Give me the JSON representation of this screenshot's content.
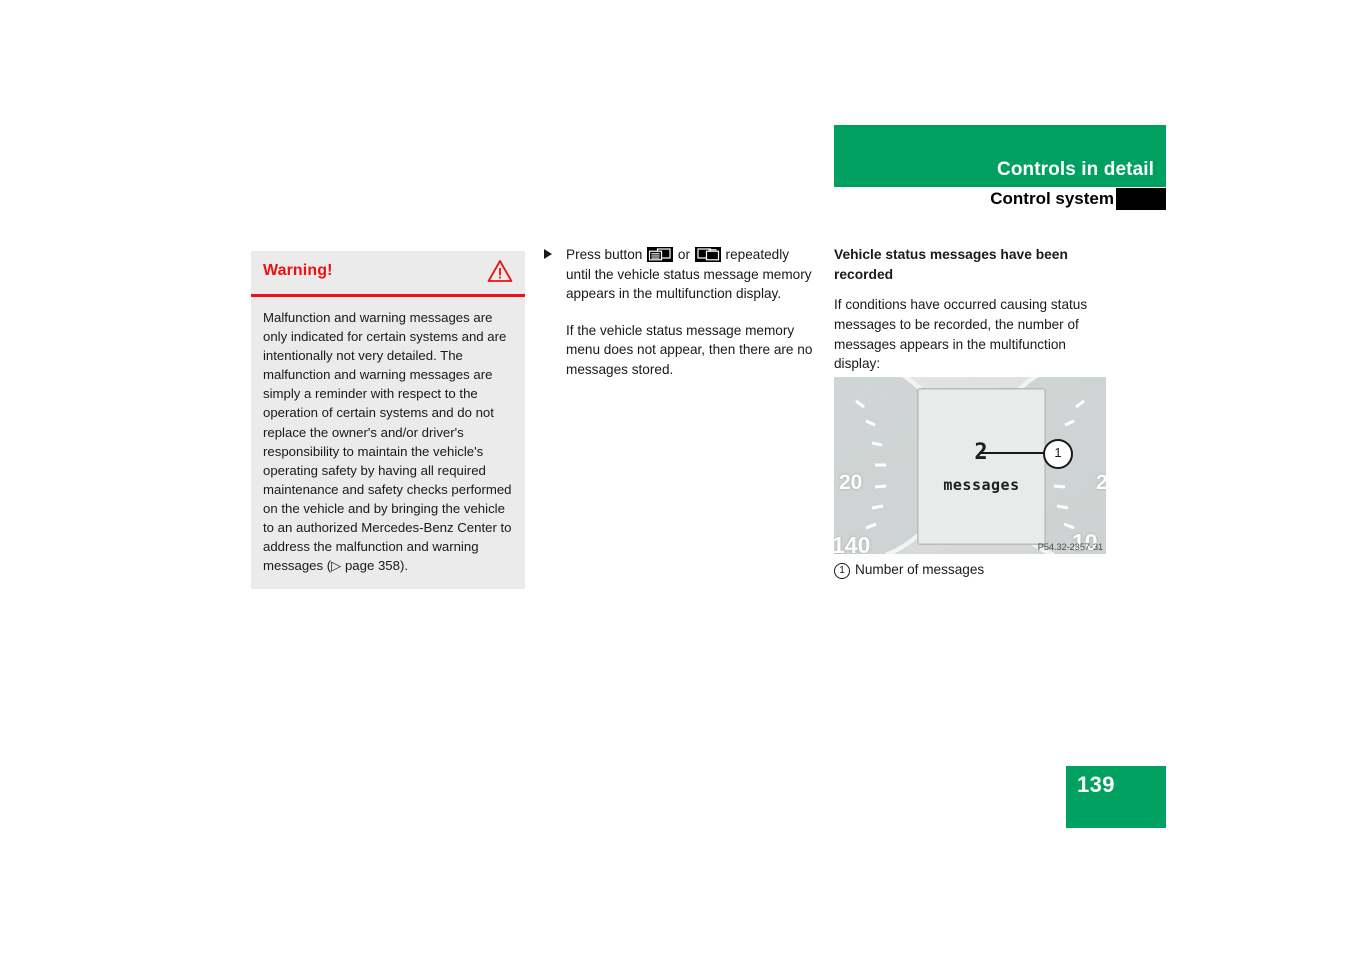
{
  "header": {
    "title": "Controls in detail",
    "subtitle": "Control system",
    "banner_color": "#00A160"
  },
  "warning": {
    "title": "Warning!",
    "icon": "warning-triangle-icon",
    "body": "Malfunction and warning messages are only indicated for certain systems and are intentionally not very detailed. The malfunction and warning messages are simply a reminder with respect to the operation of certain systems and do not replace the owner's and/or driver's responsibility to maintain the vehicle's operating safety by having all required maintenance and safety checks performed on the vehicle and by bringing the vehicle to an authorized Mercedes-Benz Center to address the malfunction and warning messages (▷ page 358).",
    "accent_color": "#ee1111",
    "background_color": "#ebebeb"
  },
  "instructions": {
    "step_prefix": "Press button",
    "step_middle": "or",
    "step_suffix": "repeatedly until the vehicle status message memory appears in the multifunction display.",
    "button_left_icon": "mfd-scroll-left-button-icon",
    "button_right_icon": "mfd-scroll-right-button-icon",
    "note": "If the vehicle status message memory menu does not appear, then there are no messages stored."
  },
  "status_section": {
    "heading": "Vehicle status messages have been recorded",
    "paragraph": "If conditions have occurred causing status messages to be recorded, the number of messages appears in the multifunction display:"
  },
  "figure": {
    "mfd_number": "2",
    "mfd_label": "messages",
    "callout_number": "1",
    "part_number": "P54.32-2357-31",
    "gauge_labels": {
      "left_upper": "20",
      "left_lower": "140",
      "right_upper": "2",
      "right_lower": "10"
    },
    "caption_number": "1",
    "caption_text": "Number of messages"
  },
  "footer": {
    "page_number": "139"
  }
}
